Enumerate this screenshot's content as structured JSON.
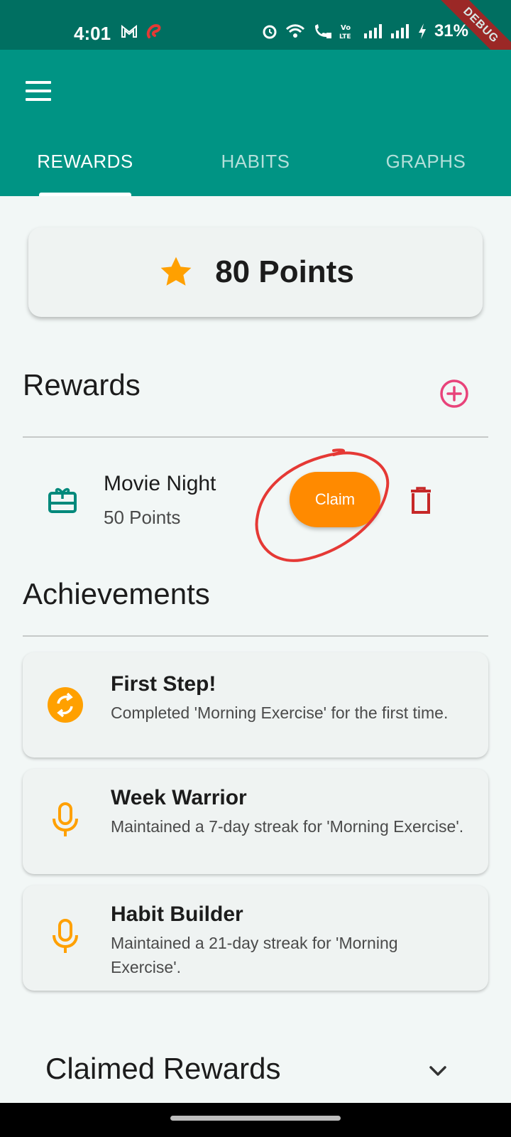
{
  "status_bar": {
    "time": "4:01",
    "battery": "31%",
    "debug_label": "DEBUG",
    "left_icons": [
      "gmail-icon",
      "airtel-icon"
    ],
    "right_icons": [
      "alarm-icon",
      "wifi-icon",
      "wifi-calling-icon",
      "volte-icon",
      "signal-icon",
      "signal-icon",
      "charging-icon"
    ]
  },
  "app_bar": {
    "menu_icon": "hamburger-menu-icon",
    "tabs": [
      {
        "label": "REWARDS",
        "active": true
      },
      {
        "label": "HABITS",
        "active": false
      },
      {
        "label": "GRAPHS",
        "active": false
      }
    ]
  },
  "points": {
    "text": "80 Points",
    "icon": "star-icon"
  },
  "rewards_section": {
    "title": "Rewards",
    "add_icon": "add-circle-icon",
    "items": [
      {
        "name": "Movie Night",
        "cost": "50 Points",
        "icon": "gift-card-icon",
        "claim_label": "Claim",
        "delete_icon": "trash-icon"
      }
    ]
  },
  "achievements_section": {
    "title": "Achievements",
    "items": [
      {
        "title": "First Step!",
        "description": "Completed 'Morning Exercise' for the first time.",
        "icon": "sync-circle-icon"
      },
      {
        "title": "Week Warrior",
        "description": "Maintained a 7-day streak for 'Morning Exercise'.",
        "icon": "microphone-icon"
      },
      {
        "title": "Habit Builder",
        "description": "Maintained a 21-day streak for 'Morning Exercise'.",
        "icon": "microphone-icon"
      }
    ]
  },
  "claimed_section": {
    "title": "Claimed Rewards",
    "expand_icon": "chevron-down-icon"
  },
  "colors": {
    "status_bar": "#006f61",
    "app_bar": "#009484",
    "accent_orange": "#ff8a00",
    "star": "#ffa000",
    "add_button": "#e8437a",
    "delete": "#c62828",
    "reward_icon": "#00897b",
    "annotation_circle": "#e53935",
    "background": "#f2f7f6"
  }
}
